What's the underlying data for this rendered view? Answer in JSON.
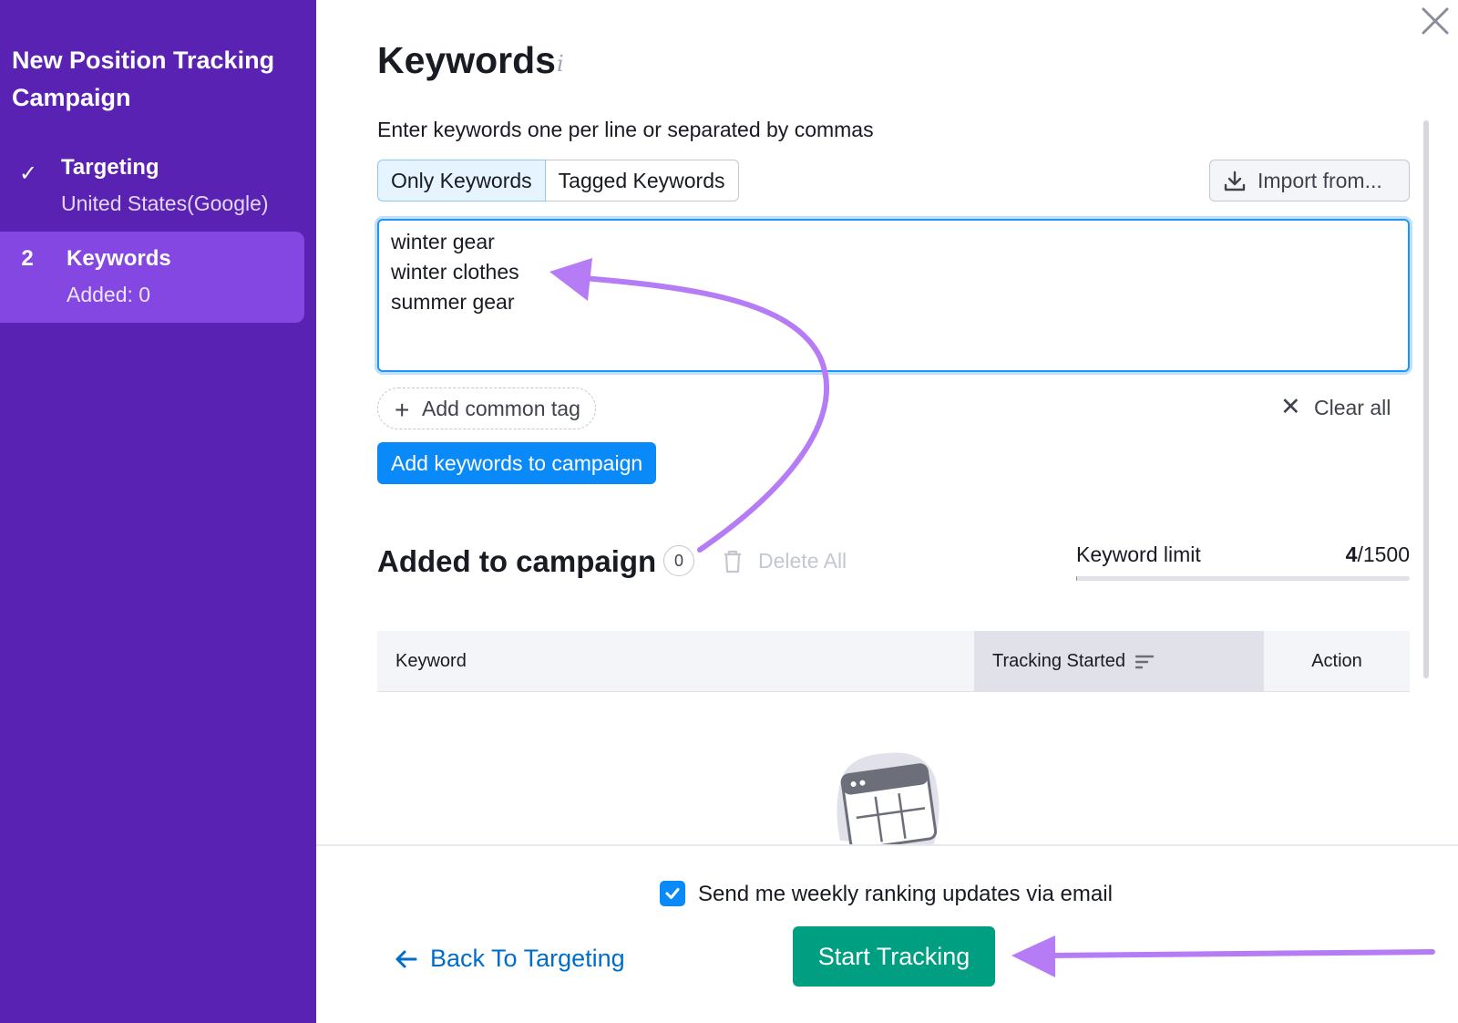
{
  "sidebar": {
    "title": "New Position Tracking Campaign",
    "steps": [
      {
        "mark": "✓",
        "title": "Targeting",
        "subtitle": "United States(Google)"
      },
      {
        "mark": "2",
        "title": "Keywords",
        "subtitle": "Added: 0"
      }
    ]
  },
  "main": {
    "title": "Keywords",
    "info_glyph": "i",
    "instruction": "Enter keywords one per line or separated by commas",
    "tabs": [
      {
        "label": "Only Keywords",
        "active": true
      },
      {
        "label": "Tagged Keywords",
        "active": false
      }
    ],
    "import_label": "Import from...",
    "keywords_text": "winter gear\nwinter clothes\nsummer gear",
    "add_tag_label": "Add common tag",
    "clear_all_label": "Clear all",
    "add_button_label": "Add keywords to campaign"
  },
  "campaign": {
    "title": "Added to campaign",
    "count": "0",
    "delete_all_label": "Delete All",
    "limit_label": "Keyword limit",
    "limit_used": "4",
    "limit_total": "/1500",
    "limit_fraction": 0.0027,
    "columns": [
      "Keyword",
      "Tracking Started",
      "Action"
    ]
  },
  "footer": {
    "email_label": "Send me weekly ranking updates via email",
    "email_checked": true,
    "back_label": "Back To Targeting",
    "start_label": "Start Tracking"
  },
  "colors": {
    "sidebar_bg": "#5a22b3",
    "sidebar_active": "#8447e1",
    "primary_blue": "#0a8af8",
    "start_green": "#009f81",
    "annotation_purple": "#b57cf5"
  }
}
